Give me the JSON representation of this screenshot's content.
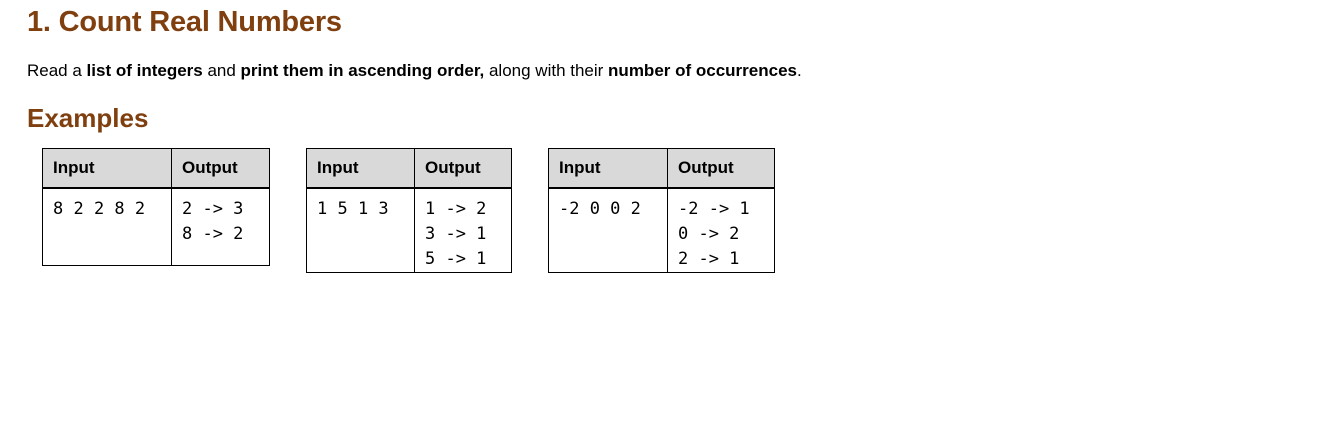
{
  "heading": "1. Count Real Numbers",
  "description": {
    "t1": "Read a ",
    "b1": "list of integers",
    "t2": " and ",
    "b2": "print them in ascending order,",
    "t3": " along with their ",
    "b3": "number of occurrences",
    "t4": "."
  },
  "examples_heading": "Examples",
  "examples": [
    {
      "input_header": "Input",
      "output_header": "Output",
      "input": "8 2 2 8 2",
      "output": [
        "2 -> 3",
        "8 -> 2"
      ]
    },
    {
      "input_header": "Input",
      "output_header": "Output",
      "input": "1 5 1 3",
      "output": [
        "1 -> 2",
        "3 -> 1",
        "5 -> 1"
      ]
    },
    {
      "input_header": "Input",
      "output_header": "Output",
      "input": "-2 0 0 2",
      "output": [
        "-2 -> 1",
        "0 -> 2",
        "2 -> 1"
      ]
    }
  ]
}
